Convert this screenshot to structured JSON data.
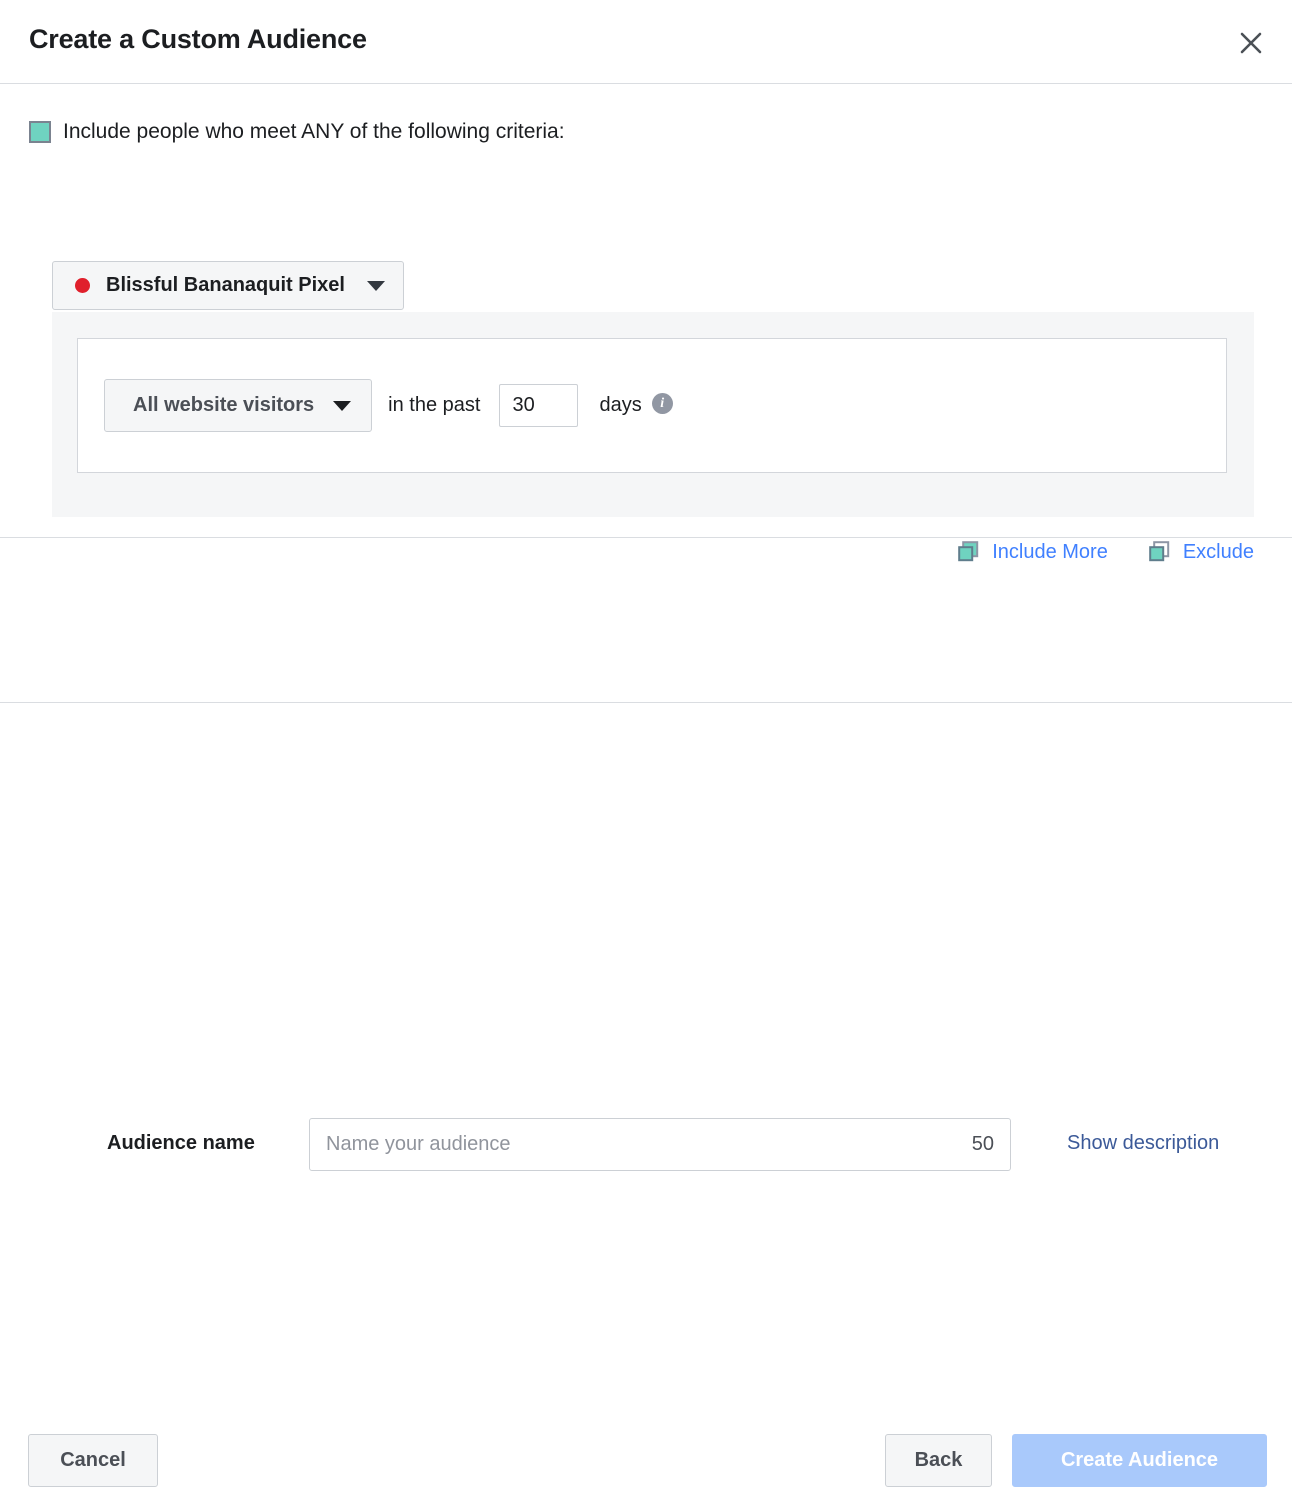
{
  "dialog": {
    "title": "Create a Custom Audience",
    "close_icon": "close-icon"
  },
  "criteria": {
    "swatch_color": "#6fd3c0",
    "label": "Include people who meet ANY of the following criteria:"
  },
  "pixel_source": {
    "name": "Blissful Bananaquit Pixel",
    "status_dot_color": "#e0202c",
    "caret_icon": "chevron-down-icon"
  },
  "rule": {
    "visitors_option": "All website visitors",
    "caret_icon": "chevron-down-icon",
    "in_the_past": "in the past",
    "days_value": "30",
    "days_word": "days",
    "info_icon": "info-icon",
    "info_glyph": "i"
  },
  "rule_actions": [
    {
      "label": "Include More",
      "icon": "stack-filled-icon"
    },
    {
      "label": "Exclude",
      "icon": "stack-outline-icon"
    }
  ],
  "audience_name": {
    "label": "Audience name",
    "placeholder": "Name your audience",
    "value": "",
    "char_counter": "50",
    "description_link": "Show description"
  },
  "footer": {
    "cancel_label": "Cancel",
    "back_label": "Back",
    "create_label": "Create Audience",
    "create_enabled": false
  },
  "colors": {
    "link_blue": "#4080ff",
    "description_blue": "#3b5998",
    "primary_disabled": "#a9c9fb",
    "accent_green": "#6fd3c0",
    "panel_gray": "#f5f6f7",
    "border_gray": "#ccd0d5"
  }
}
